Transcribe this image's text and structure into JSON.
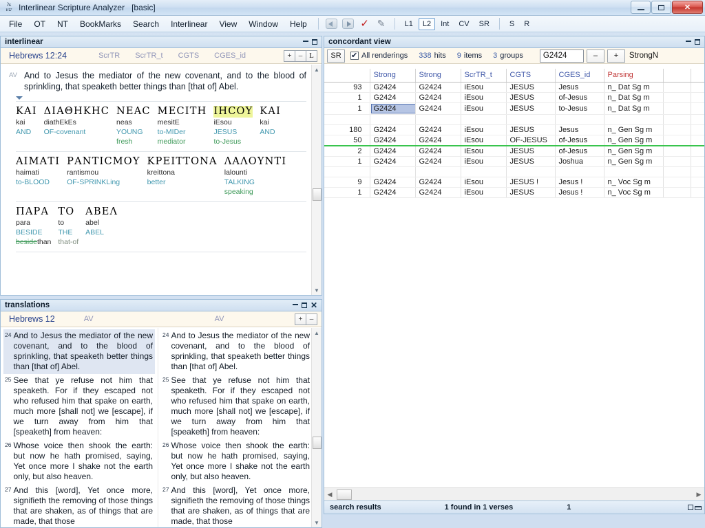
{
  "window": {
    "title": "Interlinear Scripture Analyzer   [basic]",
    "icon": "app-icon",
    "minimize": "–",
    "maximize": "□",
    "close": "✕"
  },
  "menu": {
    "items": [
      "File",
      "OT",
      "NT",
      "BookMarks",
      "Search",
      "Interlinear",
      "View",
      "Window",
      "Help"
    ]
  },
  "toolbar": {
    "icons": [
      "back-arrow-icon",
      "forward-arrow-icon",
      "check-icon",
      "pencil-icon"
    ],
    "toggles": [
      {
        "label": "L1",
        "active": false
      },
      {
        "label": "L2",
        "active": true
      },
      {
        "label": "Int",
        "active": false
      },
      {
        "label": "CV",
        "active": false
      },
      {
        "label": "SR",
        "active": false
      }
    ],
    "toggles2": [
      {
        "label": "S",
        "active": false
      },
      {
        "label": "R",
        "active": false
      }
    ]
  },
  "interlinear": {
    "panel_title": "interlinear",
    "reference": "Hebrews 12:24",
    "columns": [
      "ScrTR",
      "ScrTR_t",
      "CGTS",
      "CGES_id"
    ],
    "buttons": [
      "+",
      "–",
      "L"
    ],
    "av_tag": "AV",
    "av_text": "And to Jesus the mediator of the new covenant, and to the blood of sprinkling, that speaketh better things than [that of] Abel.",
    "rows": [
      [
        {
          "greek": "ΚΑΙ",
          "translit": "kai",
          "gloss": "AND",
          "gloss2": "",
          "highlight": false
        },
        {
          "greek": "ΔΙΑΘΗΚΗС",
          "translit": "diathEkEs",
          "gloss": "OF-covenant",
          "gloss2": "",
          "highlight": false
        },
        {
          "greek": "ΝΕΑС",
          "translit": "neas",
          "gloss": "YOUNG",
          "gloss2": "fresh",
          "highlight": false
        },
        {
          "greek": "ΜΕСΙΤΗ",
          "translit": "mesitE",
          "gloss": "to-MIDer",
          "gloss2": "mediator",
          "highlight": false
        },
        {
          "greek": "ΙΗСΟΥ",
          "translit": "iEsou",
          "gloss": "JESUS",
          "gloss2": "to-Jesus",
          "highlight": true
        },
        {
          "greek": "ΚΑΙ",
          "translit": "kai",
          "gloss": "AND",
          "gloss2": "",
          "highlight": false
        }
      ],
      [
        {
          "greek": "ΑΙΜΑΤΙ",
          "translit": "haimati",
          "gloss": "to-BLOOD",
          "gloss2": "",
          "highlight": false
        },
        {
          "greek": "ΡΑΝΤΙСΜΟΥ",
          "translit": "rantismou",
          "gloss": "OF-SPRINKLing",
          "gloss2": "",
          "highlight": false
        },
        {
          "greek": "ΚΡΕΙΤΤΟΝΑ",
          "translit": "kreittona",
          "gloss": "better",
          "gloss2": "",
          "highlight": false
        },
        {
          "greek": "ΛΑΛΟΥΝΤΙ",
          "translit": "lalounti",
          "gloss": "TALKING",
          "gloss2": "speaking",
          "highlight": false
        }
      ],
      [
        {
          "greek": "ΠΑΡΑ",
          "translit": "para",
          "gloss": "BESIDE",
          "gloss2": "beside",
          "gloss2_strike": "beside",
          "gloss2_after": "than",
          "highlight": false
        },
        {
          "greek": "ΤΟ",
          "translit": "to",
          "gloss": "THE",
          "gloss2": "that-of",
          "highlight": false
        },
        {
          "greek": "ΑΒΕΛ",
          "translit": "abel",
          "gloss": "ABEL",
          "gloss2": "",
          "highlight": false
        }
      ]
    ]
  },
  "translations": {
    "panel_title": "translations",
    "reference": "Hebrews 12",
    "version_left": "AV",
    "version_right": "AV",
    "buttons": [
      "+",
      "–"
    ],
    "verses": [
      {
        "num": "24",
        "text": "And to Jesus the mediator of the new covenant, and to the blood of sprinkling, that speaketh better things than [that of] Abel.",
        "highlight": true
      },
      {
        "num": "25",
        "text": "See that ye refuse not him that speaketh. For if they escaped not who refused him that spake on earth, much more [shall not] we [escape], if we turn away from him that [speaketh] from heaven:",
        "highlight": false
      },
      {
        "num": "26",
        "text": "Whose voice then shook the earth: but now he hath promised, saying, Yet once more I shake not the earth only, but also heaven.",
        "highlight": false
      },
      {
        "num": "27",
        "text": "And this [word], Yet once more, signifieth the removing of those things that are shaken, as of things that are made, that those",
        "highlight": false
      }
    ]
  },
  "concordant": {
    "panel_title": "concordant view",
    "sr_button": "SR",
    "all_renderings_label": "All renderings",
    "hits_value": "338",
    "hits_label": "hits",
    "items_value": "9",
    "items_label": "items",
    "groups_value": "3",
    "groups_label": "groups",
    "strong_input": "G2424",
    "minus_button": "–",
    "plus_button": "+",
    "tail_label": "StrongN",
    "headers": [
      "",
      "Strong",
      "Strong",
      "ScrTR_t",
      "CGTS",
      "CGES_id",
      "Parsing",
      "",
      ""
    ],
    "rows": [
      {
        "count": "93",
        "strong1": "G2424",
        "strong2": "G2424",
        "scrtr_t": "iEsou",
        "cgts": "JESUS",
        "cges_id": "Jesus",
        "parsing": "n_ Dat Sg m",
        "selected": false,
        "group_end": false
      },
      {
        "count": "1",
        "strong1": "G2424",
        "strong2": "G2424",
        "scrtr_t": "iEsou",
        "cgts": "JESUS",
        "cges_id": "of-Jesus",
        "parsing": "n_ Dat Sg m",
        "selected": false,
        "group_end": false
      },
      {
        "count": "1",
        "strong1": "G2424",
        "strong2": "G2424",
        "scrtr_t": "iEsou",
        "cgts": "JESUS",
        "cges_id": "to-Jesus",
        "parsing": "n_ Dat Sg m",
        "selected": true,
        "group_end": false
      },
      {
        "count": "",
        "strong1": "",
        "strong2": "",
        "scrtr_t": "",
        "cgts": "",
        "cges_id": "",
        "parsing": "",
        "selected": false,
        "group_end": false
      },
      {
        "count": "180",
        "strong1": "G2424",
        "strong2": "G2424",
        "scrtr_t": "iEsou",
        "cgts": "JESUS",
        "cges_id": "Jesus",
        "parsing": "n_ Gen Sg m",
        "selected": false,
        "group_end": false
      },
      {
        "count": "50",
        "strong1": "G2424",
        "strong2": "G2424",
        "scrtr_t": "iEsou",
        "cgts": "OF-JESUS",
        "cges_id": "of-Jesus",
        "parsing": "n_ Gen Sg m",
        "selected": false,
        "group_end": true
      },
      {
        "count": "2",
        "strong1": "G2424",
        "strong2": "G2424",
        "scrtr_t": "iEsou",
        "cgts": "JESUS",
        "cges_id": "of-Jesus",
        "parsing": "n_ Gen Sg m",
        "selected": false,
        "group_end": false
      },
      {
        "count": "1",
        "strong1": "G2424",
        "strong2": "G2424",
        "scrtr_t": "iEsou",
        "cgts": "JESUS",
        "cges_id": "Joshua",
        "parsing": "n_ Gen Sg m",
        "selected": false,
        "group_end": false
      },
      {
        "count": "",
        "strong1": "",
        "strong2": "",
        "scrtr_t": "",
        "cgts": "",
        "cges_id": "",
        "parsing": "",
        "selected": false,
        "group_end": false
      },
      {
        "count": "9",
        "strong1": "G2424",
        "strong2": "G2424",
        "scrtr_t": "iEsou",
        "cgts": "JESUS !",
        "cges_id": "Jesus !",
        "parsing": "n_ Voc Sg m",
        "selected": false,
        "group_end": false
      },
      {
        "count": "1",
        "strong1": "G2424",
        "strong2": "G2424",
        "scrtr_t": "iEsou",
        "cgts": "JESUS",
        "cges_id": "Jesus !",
        "parsing": "n_ Voc Sg m",
        "selected": false,
        "group_end": false
      }
    ],
    "status": {
      "label": "search results",
      "found": "1 found in 1 verses",
      "count": "1"
    }
  },
  "colors": {
    "accent_blue": "#3f57a8",
    "gloss_teal": "#4097ae",
    "gloss_green": "#3f9a5a",
    "parsing_red": "#c23a3a",
    "highlight_yellow": "#eef59a",
    "group_green": "#39c44d"
  }
}
